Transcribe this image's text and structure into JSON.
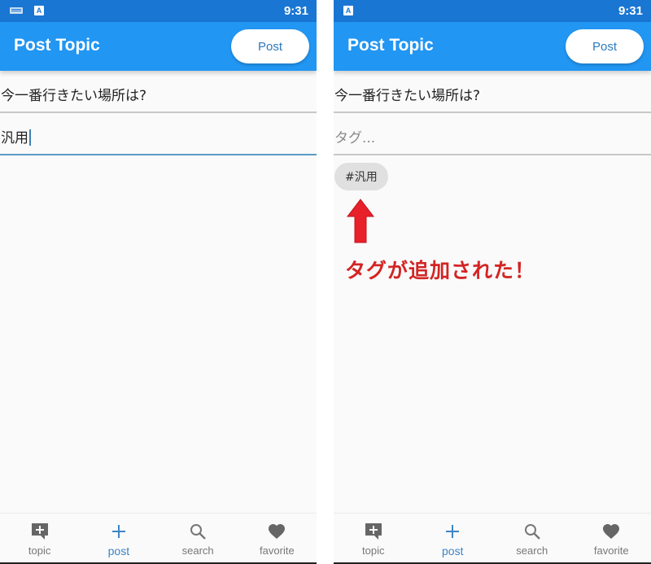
{
  "screens": {
    "before": {
      "status": {
        "time": "9:31",
        "icons": [
          "keyboard-icon",
          "a-icon"
        ],
        "a_label": "A"
      },
      "app_bar": {
        "title": "Post Topic",
        "post_label": "Post"
      },
      "title_field": {
        "value": "今一番行きたい場所は?"
      },
      "tag_field": {
        "value": "汎用",
        "placeholder": "タグ...",
        "focused": true
      }
    },
    "after": {
      "status": {
        "time": "9:31",
        "icons": [
          "a-icon"
        ],
        "a_label": "A"
      },
      "app_bar": {
        "title": "Post Topic",
        "post_label": "Post"
      },
      "title_field": {
        "value": "今一番行きたい場所は?"
      },
      "tag_field": {
        "value": "",
        "placeholder": "タグ...",
        "focused": false
      },
      "tags": [
        "#汎用"
      ],
      "annotation": {
        "text": "タグが追加された！",
        "color": "#d32424",
        "arrow_color": "#e8202a"
      }
    }
  },
  "bottom_nav": {
    "items": [
      {
        "label": "topic",
        "icon": "add-comment-icon",
        "active": false
      },
      {
        "label": "post",
        "icon": "plus-icon",
        "active": true
      },
      {
        "label": "search",
        "icon": "search-icon",
        "active": false
      },
      {
        "label": "favorite",
        "icon": "heart-icon",
        "active": false
      }
    ]
  },
  "colors": {
    "status_bar": "#1976d2",
    "app_bar": "#2196f3",
    "active_nav": "#3d85c6",
    "inactive_nav": "#777777"
  }
}
